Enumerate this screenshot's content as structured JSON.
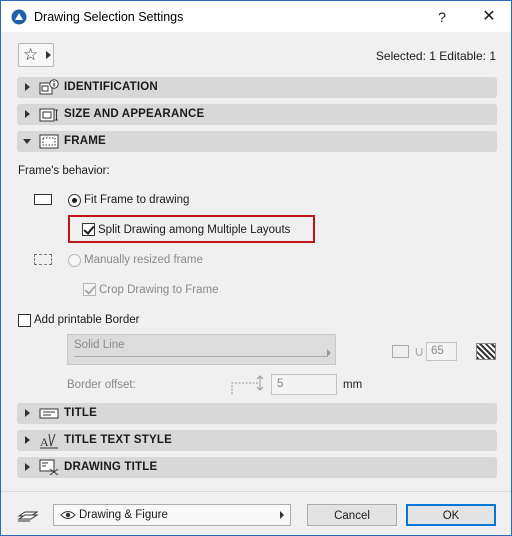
{
  "window": {
    "title": "Drawing Selection Settings",
    "help_glyph": "?",
    "close_glyph": "✕"
  },
  "header": {
    "favorites_icon": "star-icon",
    "selected_info": "Selected: 1 Editable: 1"
  },
  "sections": {
    "identification": {
      "label": "IDENTIFICATION",
      "expanded": false
    },
    "size_and_appearance": {
      "label": "SIZE AND APPEARANCE",
      "expanded": false
    },
    "frame": {
      "label": "FRAME",
      "expanded": true
    },
    "title": {
      "label": "TITLE",
      "expanded": false
    },
    "title_text_style": {
      "label": "TITLE TEXT STYLE",
      "expanded": false
    },
    "drawing_title": {
      "label": "DRAWING TITLE",
      "expanded": false
    }
  },
  "frame": {
    "behavior_label": "Frame's behavior:",
    "fit_frame_label": "Fit Frame to drawing",
    "fit_frame_selected": true,
    "split_drawing_label": "Split Drawing among Multiple Layouts",
    "split_drawing_checked": true,
    "manual_frame_label": "Manually resized frame",
    "manual_frame_selected": false,
    "crop_drawing_label": "Crop Drawing to Frame",
    "crop_drawing_checked": true,
    "add_border_label": "Add printable Border",
    "add_border_checked": false,
    "line_type_value": "Solid Line",
    "pen_number": "65",
    "border_offset_label": "Border offset:",
    "border_offset_value": "5",
    "border_offset_unit": "mm"
  },
  "footer": {
    "layer_combo_value": "Drawing & Figure",
    "cancel_label": "Cancel",
    "ok_label": "OK"
  },
  "colors": {
    "highlight_border": "#c0131a",
    "section_bg": "#d8d8d8",
    "primary_button_border": "#0078d7"
  }
}
